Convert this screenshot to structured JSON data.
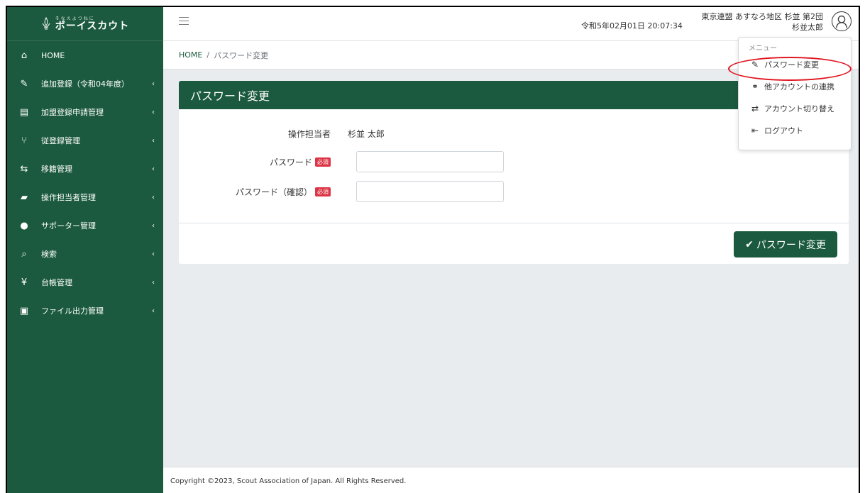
{
  "brand": {
    "subtitle": "そなえよつねに",
    "name": "ボーイスカウト"
  },
  "sidebar": {
    "items": [
      {
        "label": "HOME",
        "icon": "home-icon",
        "glyph": "⌂",
        "has_chevron": false
      },
      {
        "label": "追加登録（令和04年度）",
        "icon": "edit-icon",
        "glyph": "✎",
        "has_chevron": true
      },
      {
        "label": "加盟登録申請管理",
        "icon": "id-card-icon",
        "glyph": "▤",
        "has_chevron": true
      },
      {
        "label": "従登録管理",
        "icon": "branch-icon",
        "glyph": "⑂",
        "has_chevron": true
      },
      {
        "label": "移籍管理",
        "icon": "transfer-icon",
        "glyph": "⇆",
        "has_chevron": true
      },
      {
        "label": "操作担当者管理",
        "icon": "presenter-icon",
        "glyph": "▰",
        "has_chevron": true
      },
      {
        "label": "サポーター管理",
        "icon": "supporter-icon",
        "glyph": "●",
        "has_chevron": true
      },
      {
        "label": "検索",
        "icon": "search-icon",
        "glyph": "⌕",
        "has_chevron": true
      },
      {
        "label": "台帳管理",
        "icon": "yen-icon",
        "glyph": "¥",
        "has_chevron": true
      },
      {
        "label": "ファイル出力管理",
        "icon": "file-output-icon",
        "glyph": "▣",
        "has_chevron": true
      }
    ],
    "chevron": "‹"
  },
  "header": {
    "datetime": "令和5年02月01日 20:07:34",
    "org": "東京連盟 あすなろ地区 杉並 第2団",
    "user": "杉並太郎"
  },
  "breadcrumb": {
    "home": "HOME",
    "separator": "/",
    "current": "パスワード変更"
  },
  "card": {
    "title": "パスワード変更",
    "operator_label": "操作担当者",
    "operator_value": "杉並 太郎",
    "password_label": "パスワード",
    "password_confirm_label": "パスワード（確認）",
    "required_badge": "必須",
    "password_value": "",
    "password_confirm_value": "",
    "submit_label": "パスワード変更",
    "submit_icon": "✔"
  },
  "footer": {
    "copyright": "Copyright ©2023, Scout Association of Japan. All Rights Reserved."
  },
  "dropdown": {
    "heading": "メニュー",
    "items": [
      {
        "label": "パスワード変更",
        "icon": "pencil-icon",
        "glyph": "✎"
      },
      {
        "label": "他アカウントの連携",
        "icon": "link-icon",
        "glyph": "⚭"
      },
      {
        "label": "アカウント切り替え",
        "icon": "switch-icon",
        "glyph": "⇄"
      },
      {
        "label": "ログアウト",
        "icon": "logout-icon",
        "glyph": "⇤"
      }
    ]
  },
  "colors": {
    "primary": "#1b5a3e",
    "required": "#dc3545",
    "highlight": "#e0141e",
    "background": "#e9ecef"
  }
}
